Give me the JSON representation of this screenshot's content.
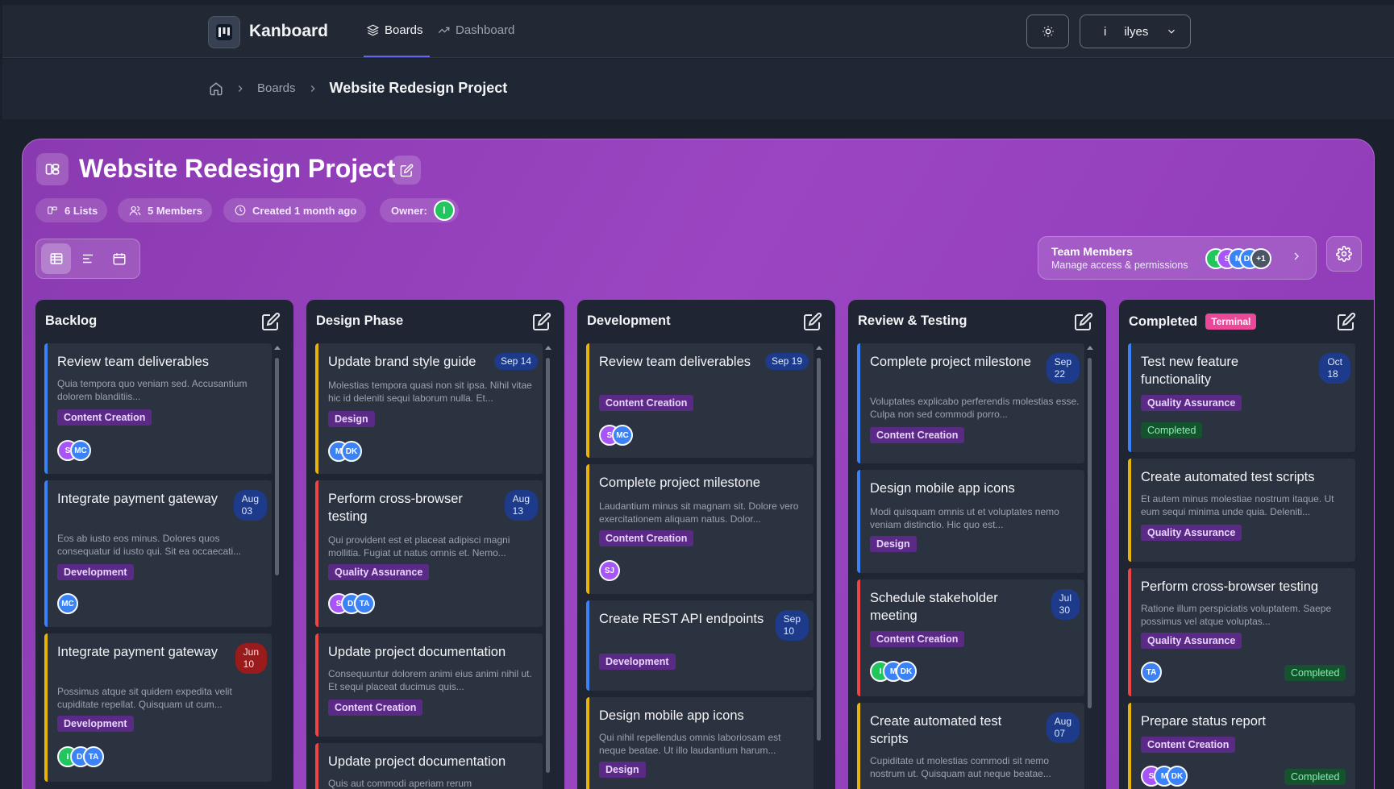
{
  "app": {
    "name": "Kanboard"
  },
  "nav": {
    "tabs": [
      {
        "label": "Boards"
      },
      {
        "label": "Dashboard"
      }
    ]
  },
  "user": {
    "avatar_letter": "i",
    "name": "ilyes"
  },
  "breadcrumb": {
    "boards": "Boards",
    "current": "Website Redesign Project"
  },
  "board": {
    "title": "Website Redesign Project",
    "meta": {
      "lists": "6 Lists",
      "members": "5 Members",
      "created": "Created 1 month ago",
      "owner_label": "Owner:",
      "owner_initial": "I"
    },
    "team": {
      "title": "Team Members",
      "subtitle": "Manage access & permissions",
      "avatars": [
        "I",
        "S",
        "M",
        "DK"
      ],
      "extra": "+1"
    }
  },
  "columns": [
    {
      "title": "Backlog",
      "cards": [
        {
          "title": "Review team deliverables",
          "desc": "Quia tempora quo veniam sed. Accusantium dolorem blanditiis...",
          "tag": "Content Creation",
          "avatars": [
            "S",
            "MC"
          ]
        },
        {
          "title": "Integrate payment gateway",
          "date1": "Aug",
          "date2": "03",
          "desc": "Eos ab iusto eos minus. Dolores quos consequatur id iusto qui. Sit ea occaecati...",
          "tag": "Development",
          "avatars": [
            "MC"
          ]
        },
        {
          "title": "Integrate payment gateway",
          "date1": "Jun",
          "date2": "10",
          "desc": "Possimus atque sit quidem expedita velit cupiditate repellat. Quisquam ut cum...",
          "tag": "Development",
          "avatars": [
            "I",
            "DI",
            "TA"
          ]
        }
      ]
    },
    {
      "title": "Design Phase",
      "cards": [
        {
          "title": "Update brand style guide",
          "date": "Sep 14",
          "desc": "Molestias tempora quasi non sit ipsa. Nihil vitae hic id deleniti sequi laborum nulla. Et...",
          "tag": "Design",
          "avatars": [
            "M",
            "DK"
          ]
        },
        {
          "title": "Perform cross-browser testing",
          "date1": "Aug",
          "date2": "13",
          "desc": "Qui provident est et placeat adipisci magni mollitia. Fugiat ut natus omnis et. Nemo...",
          "tag": "Quality Assurance",
          "avatars": [
            "S",
            "DI",
            "TA"
          ]
        },
        {
          "title": "Update project documentation",
          "desc": "Consequuntur dolorem animi eius animi nihil ut. Et sequi placeat ducimus quis...",
          "tag": "Content Creation"
        },
        {
          "title": "Update project documentation",
          "desc": "Quis aut commodi aperiam rerum"
        }
      ]
    },
    {
      "title": "Development",
      "cards": [
        {
          "title": "Review team deliverables",
          "date": "Sep 19",
          "tag": "Content Creation",
          "avatars": [
            "S",
            "MC"
          ]
        },
        {
          "title": "Complete project milestone",
          "desc": "Laudantium minus sit magnam sit. Dolore vero exercitationem aliquam natus. Dolor...",
          "tag": "Content Creation",
          "avatars": [
            "SJ"
          ]
        },
        {
          "title": "Create REST API endpoints",
          "date1": "Sep",
          "date2": "10",
          "tag": "Development"
        },
        {
          "title": "Design mobile app icons",
          "desc": "Qui nihil repellendus omnis laboriosam est neque beatae. Ut illo laudantium harum...",
          "tag": "Design"
        }
      ]
    },
    {
      "title": "Review & Testing",
      "cards": [
        {
          "title": "Complete project milestone",
          "date1": "Sep",
          "date2": "22",
          "desc": "Voluptates explicabo perferendis molestias esse. Culpa non sed commodi porro...",
          "tag": "Content Creation"
        },
        {
          "title": "Design mobile app icons",
          "desc": "Modi quisquam omnis ut et voluptates nemo veniam distinctio. Hic quo est...",
          "tag": "Design"
        },
        {
          "title": "Schedule stakeholder meeting",
          "date1": "Jul",
          "date2": "30",
          "tag": "Content Creation",
          "avatars": [
            "I",
            "M",
            "DK"
          ]
        },
        {
          "title": "Create automated test scripts",
          "date1": "Aug",
          "date2": "07",
          "desc": "Cupiditate ut molestias commodi sit nemo nostrum ut. Quisquam aut neque beatae..."
        }
      ]
    },
    {
      "title": "Completed",
      "badge": "Terminal",
      "cards": [
        {
          "title": "Test new feature functionality",
          "date1": "Oct",
          "date2": "18",
          "tag": "Quality Assurance",
          "status": "Completed"
        },
        {
          "title": "Create automated test scripts",
          "desc": "Et autem minus molestiae nostrum itaque. Ut eum sequi minima unde quia. Deleniti...",
          "tag": "Quality Assurance"
        },
        {
          "title": "Perform cross-browser testing",
          "desc": "Ratione illum perspiciatis voluptatem. Saepe possimus vel atque voluptas...",
          "tag": "Quality Assurance",
          "avatars": [
            "TA"
          ],
          "status": "Completed"
        },
        {
          "title": "Prepare status report",
          "tag": "Content Creation",
          "avatars": [
            "S",
            "M",
            "DK"
          ],
          "status": "Completed"
        }
      ]
    }
  ],
  "colors": {
    "accent": "#6366f1",
    "board_purple": "#9b45c2",
    "tag_purple": "#5b2a86",
    "card_bg": "#2b3240",
    "column_bg": "#1f2532"
  }
}
